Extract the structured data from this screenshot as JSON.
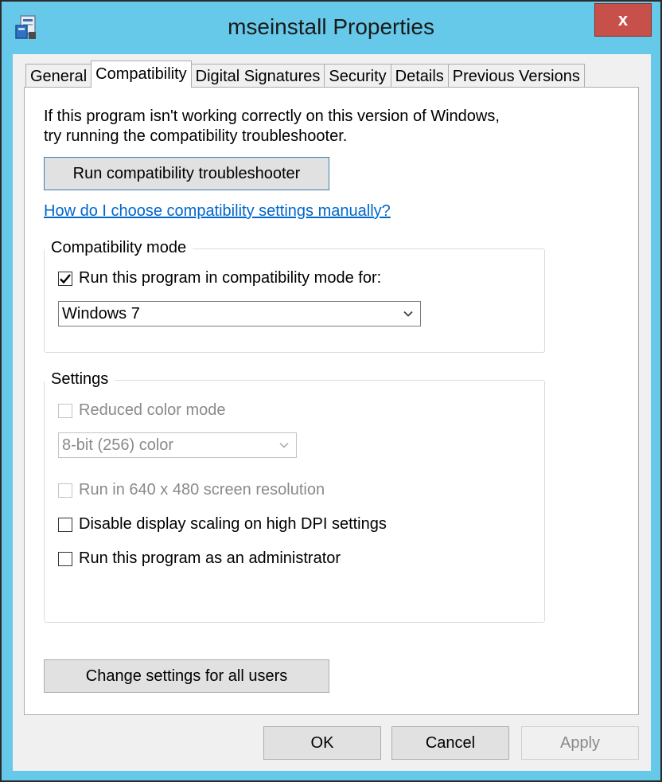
{
  "window": {
    "title": "mseinstall Properties",
    "close_label": "x",
    "accent_color": "#66c9ea",
    "close_color": "#c7504a"
  },
  "tabs": [
    {
      "label": "General",
      "active": false
    },
    {
      "label": "Compatibility",
      "active": true
    },
    {
      "label": "Digital Signatures",
      "active": false
    },
    {
      "label": "Security",
      "active": false
    },
    {
      "label": "Details",
      "active": false
    },
    {
      "label": "Previous Versions",
      "active": false
    }
  ],
  "compat": {
    "intro_line1": "If this program isn't working correctly on this version of Windows,",
    "intro_line2": "try running the compatibility troubleshooter.",
    "troubleshooter_button": "Run compatibility troubleshooter",
    "help_link": "How do I choose compatibility settings manually?",
    "mode_group": {
      "label": "Compatibility mode",
      "checkbox_label": "Run this program in compatibility mode for:",
      "checked": true,
      "selected_os": "Windows 7"
    },
    "settings_group": {
      "label": "Settings",
      "reduced_color": {
        "label": "Reduced color mode",
        "checked": false,
        "enabled": false
      },
      "color_select": {
        "value": "8-bit (256) color",
        "enabled": false
      },
      "resolution": {
        "label": "Run in 640 x 480 screen resolution",
        "checked": false,
        "enabled": false
      },
      "dpi": {
        "label": "Disable display scaling on high DPI settings",
        "checked": false,
        "enabled": true
      },
      "admin": {
        "label": "Run this program as an administrator",
        "checked": false,
        "enabled": true
      }
    },
    "all_users_button": "Change settings for all users"
  },
  "footer": {
    "ok": "OK",
    "cancel": "Cancel",
    "apply": "Apply"
  }
}
